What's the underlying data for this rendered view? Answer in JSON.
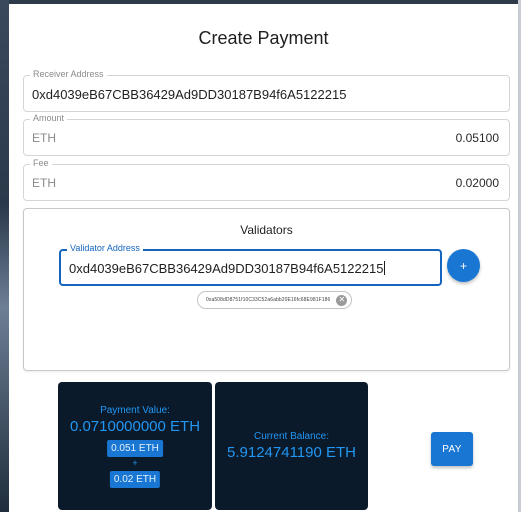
{
  "page": {
    "title": "Create Payment"
  },
  "receiver": {
    "label": "Receiver Address",
    "value": "0xd4039eB67CBB36429Ad9DD30187B94f6A5122215"
  },
  "amount": {
    "label": "Amount",
    "unit": "ETH",
    "value": "0.05100"
  },
  "fee": {
    "label": "Fee",
    "unit": "ETH",
    "value": "0.02000"
  },
  "validators": {
    "title": "Validators",
    "input_label": "Validator Address",
    "input_value": "0xd4039eB67CBB36429Ad9DD30187B94f6A5122215",
    "add_label": "+",
    "chips": [
      {
        "address": "0xa508dD8751f10C33C52a6abb20E16fc68E981F186"
      }
    ]
  },
  "payment_value": {
    "label": "Payment Value:",
    "total": "0.0710000000 ETH",
    "amount_pill": "0.051 ETH",
    "plus": "+",
    "fee_pill": "0.02 ETH"
  },
  "balance": {
    "label": "Current Balance:",
    "value": "5.9124741190 ETH"
  },
  "actions": {
    "pay_label": "PAY"
  },
  "colors": {
    "primary": "#1976d2",
    "panel_bg": "#0b1a2a",
    "accent_text": "#2196f3"
  }
}
